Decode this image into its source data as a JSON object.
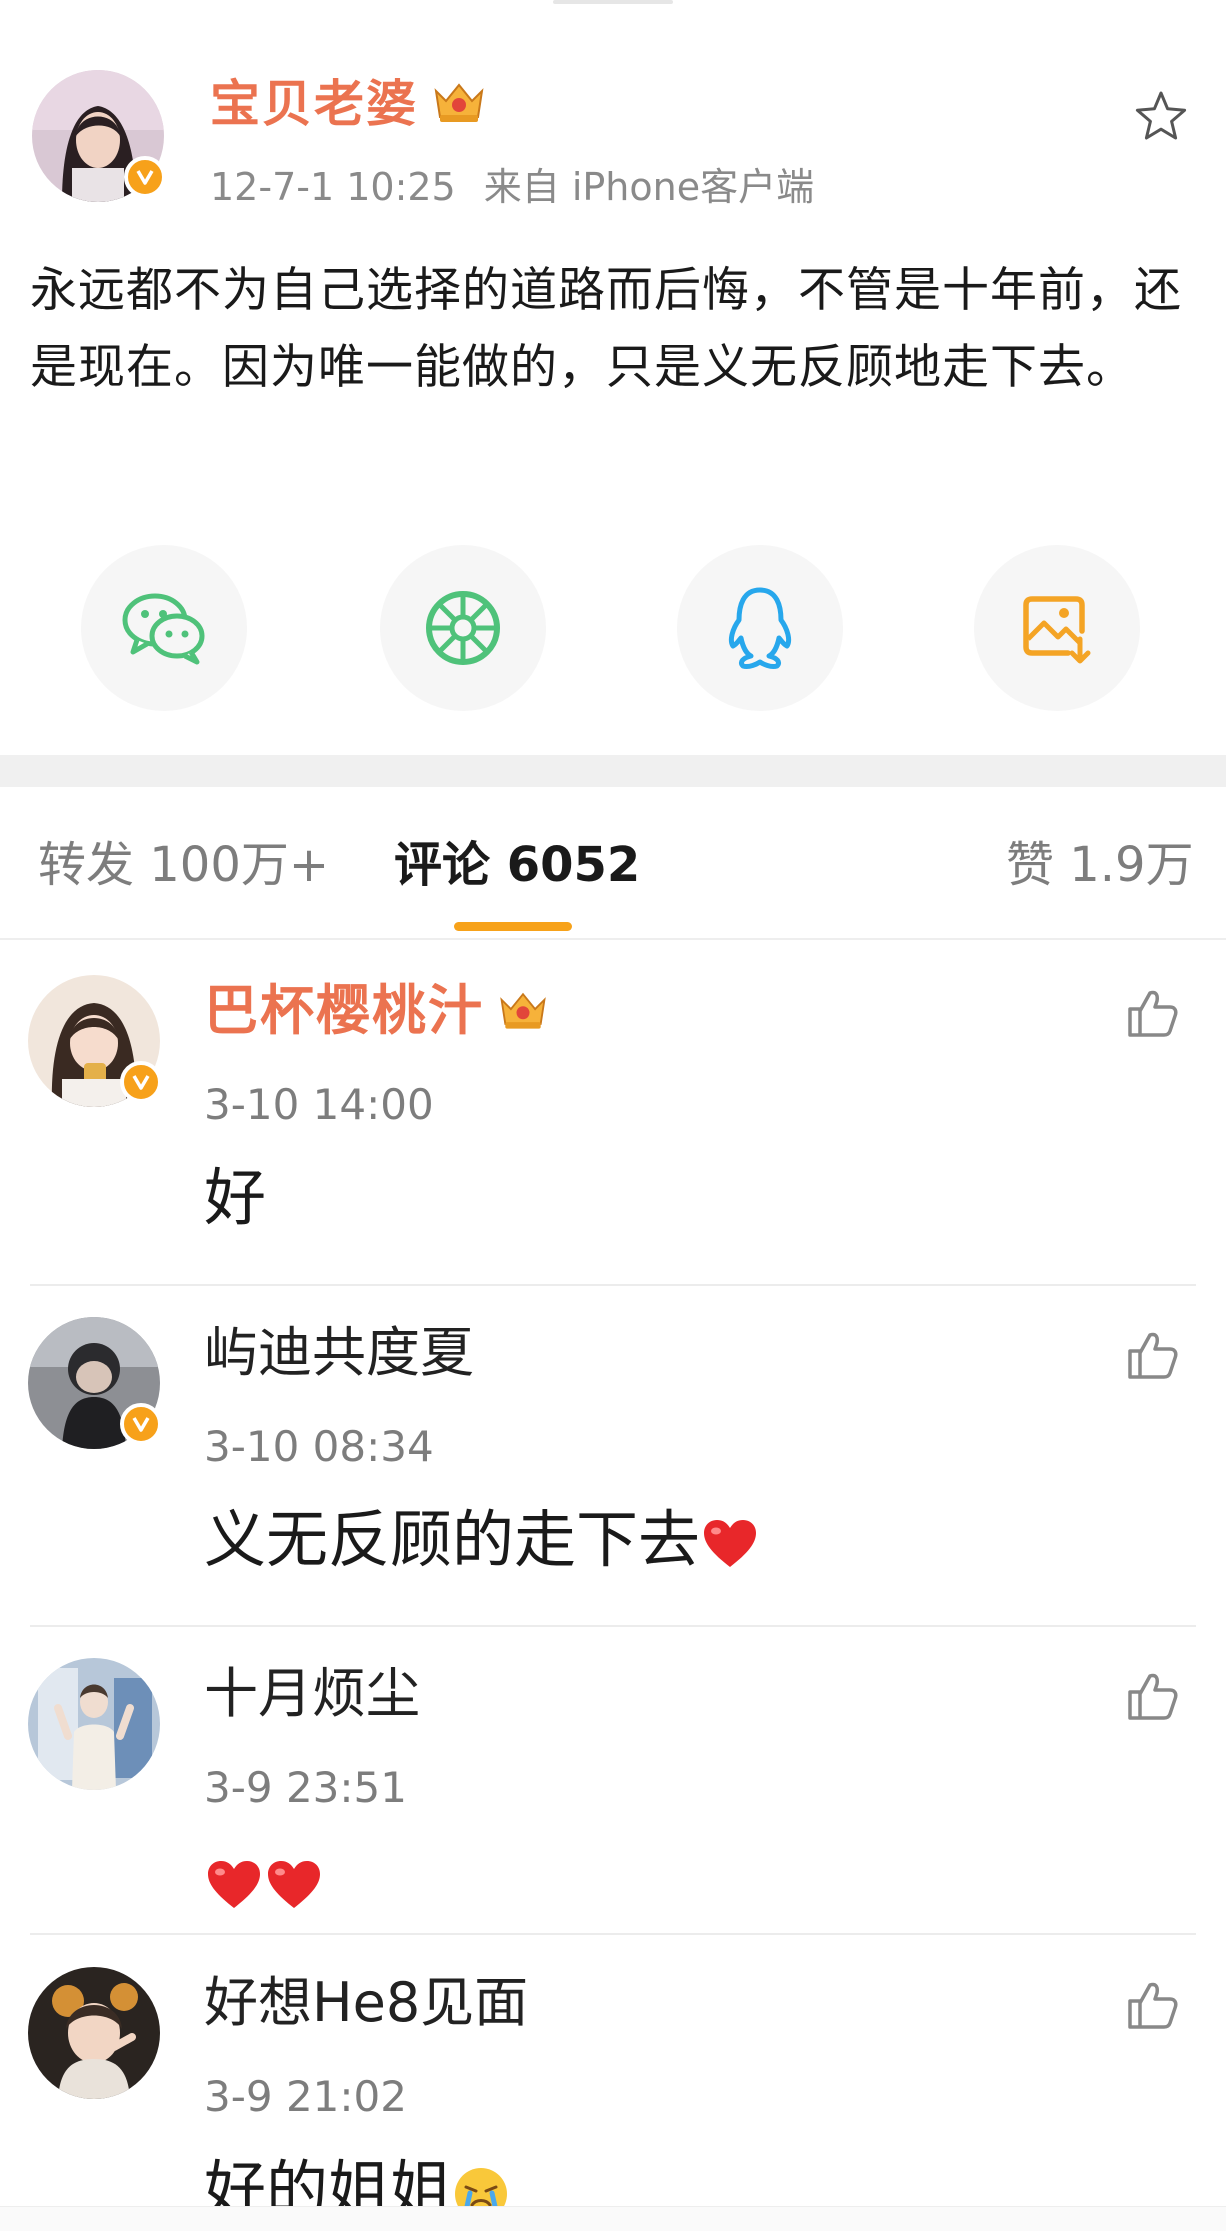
{
  "post": {
    "author": "宝贝老婆",
    "date": "12-7-1 10:25",
    "source": "来自 iPhone客户端",
    "text": "永远都不为自己选择的道路而后悔，不管是十年前，还是现在。因为唯一能做的，只是义无反顾地走下去。"
  },
  "share": {
    "icons": [
      "wechat-icon",
      "moments-icon",
      "qq-icon",
      "save-image-icon"
    ],
    "colors": {
      "wechat": "#4fc27a",
      "moments": "#4fc27a",
      "qq": "#27a7ec",
      "save": "#f4a425"
    }
  },
  "tabs": {
    "repost": "转发 100万+",
    "comments": "评论 6052",
    "likes": "赞 1.9万"
  },
  "comments": [
    {
      "author": "巴杯樱桃汁",
      "time": "3-10 14:00",
      "text": "好",
      "vip": true,
      "verified": true
    },
    {
      "author": "屿迪共度夏",
      "time": "3-10 08:34",
      "text": "义无反顾的走下去",
      "emoji": "heart",
      "vip": false,
      "verified": true
    },
    {
      "author": "十月烦尘",
      "time": "3-9 23:51",
      "text": "",
      "emoji": "heart heart",
      "vip": false,
      "verified": false
    },
    {
      "author": "好想He8见面",
      "time": "3-9 21:02",
      "text": "好的姐姐",
      "emoji": "crying-face",
      "vip": false,
      "verified": false
    }
  ],
  "colors": {
    "accent": "#eb7350",
    "tab_underline": "#f7a21a",
    "verified_badge": "#f7a11a",
    "heart": "#e8272a"
  }
}
